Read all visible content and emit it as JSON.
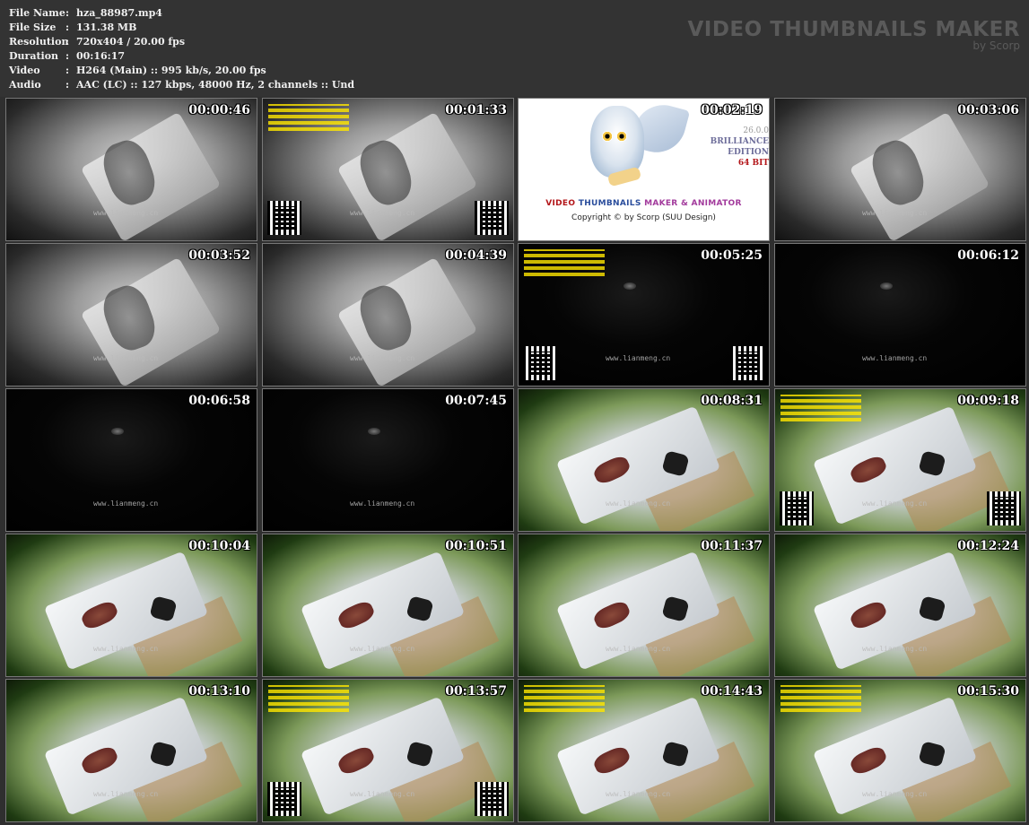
{
  "file_info": [
    {
      "label": "File Name",
      "value": "hza_88987.mp4"
    },
    {
      "label": "File Size",
      "value": "131.38 MB"
    },
    {
      "label": "Resolution",
      "value": "720x404 / 20.00 fps"
    },
    {
      "label": "Duration",
      "value": "00:16:17"
    },
    {
      "label": "Video",
      "value": "H264 (Main) :: 995 kb/s, 20.00 fps"
    },
    {
      "label": "Audio",
      "value": "AAC (LC) :: 127 kbps, 48000 Hz, 2 channels :: Und"
    }
  ],
  "separator": ":",
  "brand": {
    "title": "VIDEO THUMBNAILS MAKER",
    "subtitle": "by Scorp"
  },
  "watermark_text": "www.lianmeng.cn",
  "logo_frame": {
    "title_parts": [
      "VIDEO ",
      "THUMBNAILS ",
      "MAKER & ANIMATOR"
    ],
    "copyright": "Copyright © by Scorp (SUU Design)",
    "version": "26.0.0",
    "edition_lines": [
      "BRILLIANCE",
      "EDITION"
    ],
    "bits": "64 BIT"
  },
  "thumbnails": [
    {
      "time": "00:00:46",
      "scene": "gray",
      "qr": false,
      "ad": false
    },
    {
      "time": "00:01:33",
      "scene": "gray",
      "qr": true,
      "ad": true
    },
    {
      "time": "00:02:19",
      "scene": "logo",
      "qr": false,
      "ad": false
    },
    {
      "time": "00:03:06",
      "scene": "gray",
      "qr": false,
      "ad": false
    },
    {
      "time": "00:03:52",
      "scene": "gray",
      "qr": false,
      "ad": false
    },
    {
      "time": "00:04:39",
      "scene": "gray",
      "qr": false,
      "ad": false
    },
    {
      "time": "00:05:25",
      "scene": "dark",
      "qr": true,
      "ad": true
    },
    {
      "time": "00:06:12",
      "scene": "dark",
      "qr": false,
      "ad": false
    },
    {
      "time": "00:06:58",
      "scene": "dark",
      "qr": false,
      "ad": false
    },
    {
      "time": "00:07:45",
      "scene": "dark",
      "qr": false,
      "ad": false
    },
    {
      "time": "00:08:31",
      "scene": "green",
      "qr": false,
      "ad": false
    },
    {
      "time": "00:09:18",
      "scene": "green",
      "qr": true,
      "ad": true
    },
    {
      "time": "00:10:04",
      "scene": "green",
      "qr": false,
      "ad": false
    },
    {
      "time": "00:10:51",
      "scene": "green",
      "qr": false,
      "ad": false
    },
    {
      "time": "00:11:37",
      "scene": "green",
      "qr": false,
      "ad": false
    },
    {
      "time": "00:12:24",
      "scene": "green",
      "qr": false,
      "ad": false
    },
    {
      "time": "00:13:10",
      "scene": "green",
      "qr": false,
      "ad": false
    },
    {
      "time": "00:13:57",
      "scene": "green",
      "qr": true,
      "ad": true
    },
    {
      "time": "00:14:43",
      "scene": "green",
      "qr": false,
      "ad": true
    },
    {
      "time": "00:15:30",
      "scene": "green",
      "qr": false,
      "ad": true
    }
  ]
}
